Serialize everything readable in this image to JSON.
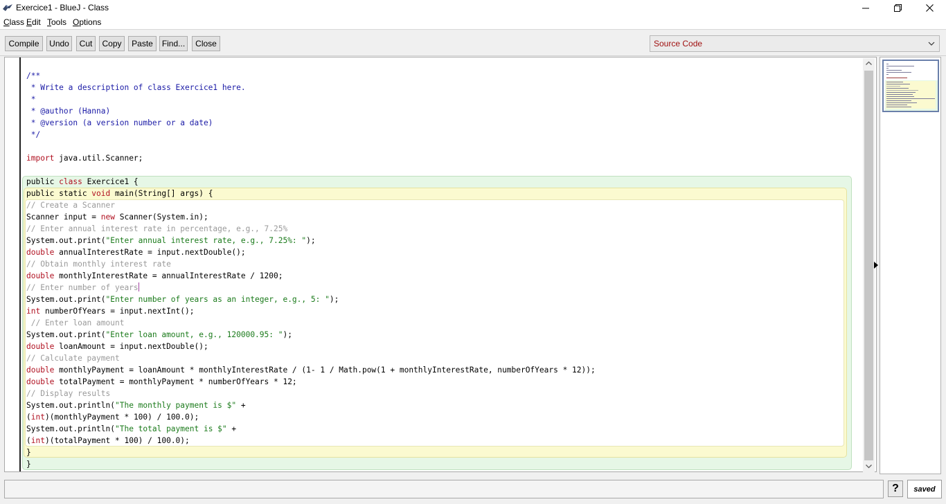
{
  "window": {
    "title": "Exercice1 - BlueJ - Class"
  },
  "menu": [
    {
      "first": "C",
      "rest": "lass"
    },
    {
      "first": "E",
      "rest": "dit"
    },
    {
      "first": "T",
      "rest": "ools"
    },
    {
      "first": "O",
      "rest": "ptions"
    }
  ],
  "toolbar": {
    "compile": "Compile",
    "undo": "Undo",
    "cut": "Cut",
    "copy": "Copy",
    "paste": "Paste",
    "find": "Find...",
    "close": "Close",
    "view_selected": "Source Code"
  },
  "code": {
    "l01": "/**",
    "l02": " * Write a description of class Exercice1 here.",
    "l03": " *",
    "l04": " * @author (Hanna)",
    "l05": " * @version (a version number or a date)",
    "l06": " */",
    "l07_kw": "import",
    "l07_rest": " java.util.Scanner;",
    "l08_a": "public ",
    "l08_kw": "class",
    "l08_b": " Exercice1 {",
    "l09_a": "public static ",
    "l09_kw": "void",
    "l09_b": " main(String[] args) {",
    "l10": "// Create a Scanner",
    "l11_a": "Scanner input = ",
    "l11_kw": "new",
    "l11_b": " Scanner(System.in);",
    "l12": "// Enter annual interest rate in percentage, e.g., 7.25%",
    "l13_a": "System.out.print(",
    "l13_str": "\"Enter annual interest rate, e.g., 7.25%: \"",
    "l13_b": ");",
    "l14_kw": "double",
    "l14_rest": " annualInterestRate = input.nextDouble();",
    "l15": "// Obtain monthly interest rate",
    "l16_kw": "double",
    "l16_rest": " monthlyInterestRate = annualInterestRate / 1200;",
    "l17": "// Enter number of years",
    "l18_a": "System.out.print(",
    "l18_str": "\"Enter number of years as an integer, e.g., 5: \"",
    "l18_b": ");",
    "l19_kw": "int",
    "l19_rest": " numberOfYears = input.nextInt();",
    "l20": " // Enter loan amount",
    "l21_a": "System.out.print(",
    "l21_str": "\"Enter loan amount, e.g., 120000.95: \"",
    "l21_b": ");",
    "l22_kw": "double",
    "l22_rest": " loanAmount = input.nextDouble();",
    "l23": "// Calculate payment",
    "l24_kw": "double",
    "l24_rest": " monthlyPayment = loanAmount * monthlyInterestRate / (1- 1 / Math.pow(1 + monthlyInterestRate, numberOfYears * 12));",
    "l25_kw": "double",
    "l25_rest": " totalPayment = monthlyPayment * numberOfYears * 12;",
    "l26": "// Display results",
    "l27_a": "System.out.println(",
    "l27_str": "\"The monthly payment is $\"",
    "l27_b": " +",
    "l28_a": "(",
    "l28_kw": "int",
    "l28_b": ")(monthlyPayment * 100) / 100.0);",
    "l29_a": "System.out.println(",
    "l29_str": "\"The total payment is $\"",
    "l29_b": " +",
    "l30_a": "(",
    "l30_kw": "int",
    "l30_b": ")(totalPayment * 100) / 100.0);",
    "l31": "}",
    "l32": "}"
  },
  "status": {
    "message": "",
    "help": "?",
    "saved": "saved"
  },
  "colors": {
    "keyword": "#b01020",
    "comment": "#1a1aa6",
    "line_comment": "#9a9a9a",
    "string": "#1a7a1a",
    "class_scope": "#e6f7e6",
    "method_scope": "#fbfad0"
  },
  "icons": {
    "app": "bluej-bird-icon",
    "minimize": "minimize-icon",
    "maximize": "restore-icon",
    "close": "close-icon",
    "dropdown": "chevron-down-icon",
    "help": "help-icon"
  }
}
